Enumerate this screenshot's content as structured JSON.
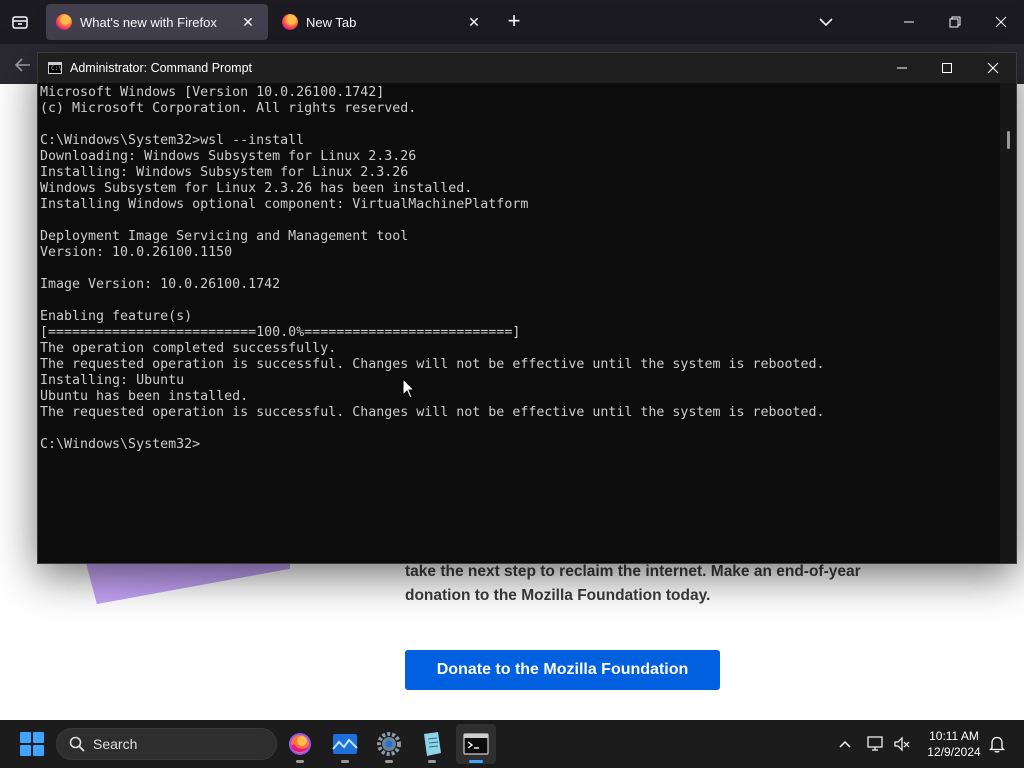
{
  "firefox": {
    "tabs": [
      {
        "title": "What's new with Firefox",
        "active": true
      },
      {
        "title": "New Tab",
        "active": false
      }
    ],
    "page": {
      "donate_text": "take the next step to reclaim the internet. Make an end-of-year donation to the Mozilla Foundation today.",
      "donate_button": "Donate to the Mozilla Foundation"
    },
    "colors": {
      "tabbar": "#1c1b22",
      "active_tab": "#42414d",
      "donate_button": "#0060df"
    }
  },
  "cmd": {
    "title": "Administrator: Command Prompt",
    "lines": [
      "Microsoft Windows [Version 10.0.26100.1742]",
      "(c) Microsoft Corporation. All rights reserved.",
      "",
      "C:\\Windows\\System32>wsl --install",
      "Downloading: Windows Subsystem for Linux 2.3.26",
      "Installing: Windows Subsystem for Linux 2.3.26",
      "Windows Subsystem for Linux 2.3.26 has been installed.",
      "Installing Windows optional component: VirtualMachinePlatform",
      "",
      "Deployment Image Servicing and Management tool",
      "Version: 10.0.26100.1150",
      "",
      "Image Version: 10.0.26100.1742",
      "",
      "Enabling feature(s)",
      "[==========================100.0%==========================]",
      "The operation completed successfully.",
      "The requested operation is successful. Changes will not be effective until the system is rebooted.",
      "Installing: Ubuntu",
      "Ubuntu has been installed.",
      "The requested operation is successful. Changes will not be effective until the system is rebooted.",
      "",
      "C:\\Windows\\System32>"
    ],
    "colors": {
      "background": "#0c0c0c",
      "text": "#cccccc"
    }
  },
  "taskbar": {
    "search_label": "Search",
    "apps": [
      {
        "name": "firefox-icon",
        "running": true,
        "active": false
      },
      {
        "name": "photos-icon",
        "running": true,
        "active": false
      },
      {
        "name": "settings-icon",
        "running": true,
        "active": false
      },
      {
        "name": "notepad-icon",
        "running": true,
        "active": false
      },
      {
        "name": "terminal-icon",
        "running": true,
        "active": true
      }
    ],
    "time": "10:11 AM",
    "date": "12/9/2024",
    "accent": "#3ea6ff"
  }
}
